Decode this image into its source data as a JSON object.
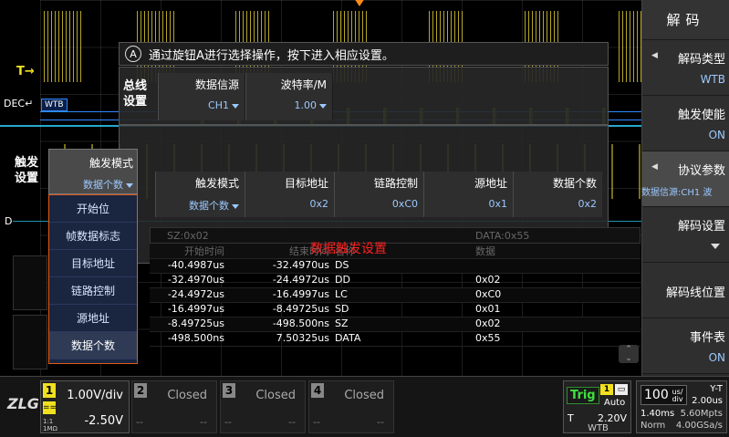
{
  "colors": {
    "accent": "#2f88ff",
    "ch1": "#f0e020",
    "warning": "#ff2020",
    "trig_ok": "#3fe03f",
    "dropdown_border": "#e05a1a"
  },
  "scope": {
    "trigger_marker": "T",
    "dec_label": "DEC",
    "dec_badge": "WTB",
    "d_label": "D"
  },
  "message": {
    "icon": "A",
    "text": "通过旋钮A进行选择操作，按下进入相应设置。"
  },
  "bus_settings": {
    "title": "总线设置",
    "cells": [
      {
        "label": "数据信源",
        "value": "CH1"
      },
      {
        "label": "波特率/M",
        "value": "1.00"
      }
    ]
  },
  "trigger_settings": {
    "title": "触发设置",
    "mode_label": "触发模式",
    "mode_value": "数据个数",
    "cells": [
      {
        "label": "触发模式",
        "value": "数据个数"
      },
      {
        "label": "目标地址",
        "value": "0x2"
      },
      {
        "label": "链路控制",
        "value": "0xC0"
      },
      {
        "label": "源地址",
        "value": "0x1"
      },
      {
        "label": "数据个数",
        "value": "0x2"
      }
    ],
    "caption": "数据触发设置",
    "dropdown": [
      {
        "label": "开始位",
        "selected": false
      },
      {
        "label": "帧数据标志",
        "selected": false
      },
      {
        "label": "目标地址",
        "selected": false
      },
      {
        "label": "链路控制",
        "selected": false
      },
      {
        "label": "源地址",
        "selected": false
      },
      {
        "label": "数据个数",
        "selected": true
      }
    ]
  },
  "event_table": {
    "summary_left": "SZ:0x02",
    "summary_right": "DATA:0x55",
    "headers": [
      "开始时间",
      "结束时间",
      "名称",
      "数据"
    ],
    "rows": [
      [
        "-40.4987us",
        "-32.4970us",
        "DS",
        ""
      ],
      [
        "-32.4970us",
        "-24.4972us",
        "DD",
        "0x02"
      ],
      [
        "-24.4972us",
        "-16.4997us",
        "LC",
        "0xC0"
      ],
      [
        "-16.4997us",
        "-8.49725us",
        "SD",
        "0x01"
      ],
      [
        "-8.49725us",
        "-498.500ns",
        "SZ",
        "0x02"
      ],
      [
        "-498.500ns",
        "7.50325us",
        "DATA",
        "0x55"
      ]
    ]
  },
  "right_menu": {
    "title": "解码",
    "items": [
      {
        "label": "解码类型",
        "value": "WTB"
      },
      {
        "label": "触发使能",
        "value": "ON"
      },
      {
        "label": "协议参数",
        "value": "数据信源:CH1 波"
      },
      {
        "label": "解码设置",
        "value": ""
      },
      {
        "label": "解码线位置",
        "value": ""
      },
      {
        "label": "事件表",
        "value": "ON"
      }
    ]
  },
  "status": {
    "logo": "ZLG",
    "ch1": {
      "num": "1",
      "coupling": "==",
      "impedance1": "1:1",
      "impedance2": "1MΩ",
      "vdiv": "1.00V/div",
      "offset": "-2.50V"
    },
    "channels": [
      {
        "num": "2",
        "state": "Closed",
        "d1": "--",
        "d2": "--"
      },
      {
        "num": "3",
        "state": "Closed",
        "d1": "--",
        "d2": "--"
      },
      {
        "num": "4",
        "state": "Closed",
        "d1": "--",
        "d2": "--"
      }
    ],
    "trigger": {
      "state": "Trig",
      "chip": "1",
      "mode": "Auto",
      "type": "T",
      "level": "2.20V",
      "source": "WTB"
    },
    "timebase": {
      "value": "100",
      "unit_top": "us/",
      "unit_bottom": "div",
      "mode": "Y-T",
      "delay": "2.00us",
      "pos": "1.40ms",
      "mem": "5.60Mpts",
      "acq": "Norm",
      "rate": "4.00GSa/s"
    }
  }
}
